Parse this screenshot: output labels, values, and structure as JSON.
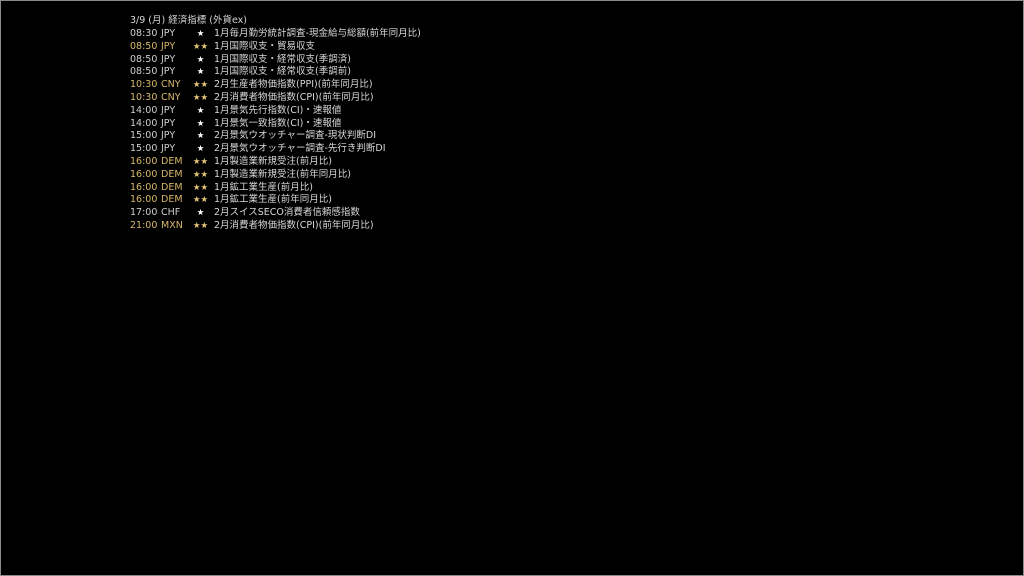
{
  "header": {
    "title": "3/9 (月) 経済指標 (外貨ex)"
  },
  "events": [
    {
      "time": "08:30",
      "currency": "JPY",
      "stars": "★",
      "importance": "low",
      "name": "1月毎月勤労統計調査-現金給与総額(前年同月比)"
    },
    {
      "time": "08:50",
      "currency": "JPY",
      "stars": "★★",
      "importance": "high",
      "name": "1月国際収支・貿易収支"
    },
    {
      "time": "08:50",
      "currency": "JPY",
      "stars": "★",
      "importance": "low",
      "name": "1月国際収支・経常収支(季調済)"
    },
    {
      "time": "08:50",
      "currency": "JPY",
      "stars": "★",
      "importance": "low",
      "name": "1月国際収支・経常収支(季調前)"
    },
    {
      "time": "10:30",
      "currency": "CNY",
      "stars": "★★",
      "importance": "high",
      "name": "2月生産者物価指数(PPI)(前年同月比)"
    },
    {
      "time": "10:30",
      "currency": "CNY",
      "stars": "★★",
      "importance": "high",
      "name": "2月消費者物価指数(CPI)(前年同月比)"
    },
    {
      "time": "14:00",
      "currency": "JPY",
      "stars": "★",
      "importance": "low",
      "name": "1月景気先行指数(CI)・速報値"
    },
    {
      "time": "14:00",
      "currency": "JPY",
      "stars": "★",
      "importance": "low",
      "name": "1月景気一致指数(CI)・速報値"
    },
    {
      "time": "15:00",
      "currency": "JPY",
      "stars": "★",
      "importance": "low",
      "name": "2月景気ウオッチャー調査-現状判断DI"
    },
    {
      "time": "15:00",
      "currency": "JPY",
      "stars": "★",
      "importance": "low",
      "name": "2月景気ウオッチャー調査-先行き判断DI"
    },
    {
      "time": "16:00",
      "currency": "DEM",
      "stars": "★★",
      "importance": "high",
      "name": "1月製造業新規受注(前月比)"
    },
    {
      "time": "16:00",
      "currency": "DEM",
      "stars": "★★",
      "importance": "high",
      "name": "1月製造業新規受注(前年同月比)"
    },
    {
      "time": "16:00",
      "currency": "DEM",
      "stars": "★★",
      "importance": "high",
      "name": "1月鉱工業生産(前月比)"
    },
    {
      "time": "16:00",
      "currency": "DEM",
      "stars": "★★",
      "importance": "high",
      "name": "1月鉱工業生産(前年同月比)"
    },
    {
      "time": "17:00",
      "currency": "CHF",
      "stars": "★",
      "importance": "low",
      "name": "2月スイスSECO消費者信頼感指数"
    },
    {
      "time": "21:00",
      "currency": "MXN",
      "stars": "★★",
      "importance": "high",
      "name": "2月消費者物価指数(CPI)(前年同月比)"
    }
  ],
  "colors": {
    "background": "#000000",
    "frame_border": "#8a8a8a",
    "high_importance_text": "#d7b86a",
    "low_importance_text": "#cfcfcf",
    "event_name_text": "#d8d8d8"
  }
}
